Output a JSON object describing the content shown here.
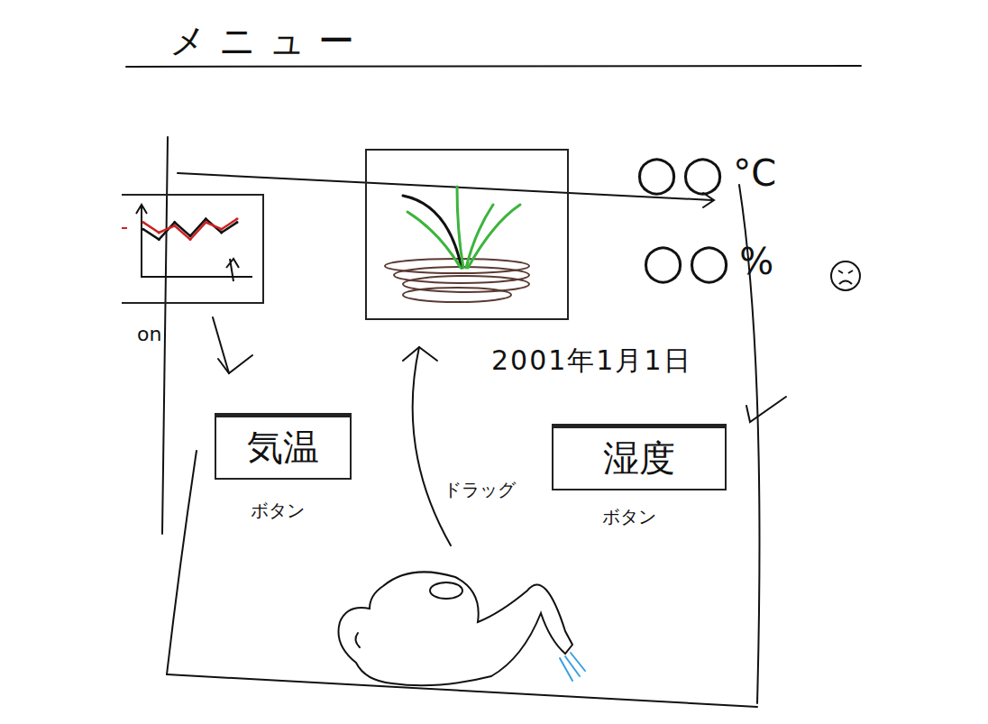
{
  "menu": {
    "title": "メニュー"
  },
  "chart": {
    "label": "on",
    "series": [
      {
        "name": "black",
        "values": [
          3,
          1.5,
          4,
          2,
          4.5,
          2.5,
          4
        ],
        "color": "#111111"
      },
      {
        "name": "red",
        "values": [
          4,
          2.5,
          3.5,
          1.5,
          4,
          3,
          4.5
        ],
        "color": "#cc2222"
      }
    ]
  },
  "readings": [
    {
      "value": "○○",
      "unit": "°C"
    },
    {
      "value": "○○",
      "unit": "%"
    }
  ],
  "date": "2001年1月1日",
  "buttons": [
    {
      "label": "気温",
      "caption": "ボタン"
    },
    {
      "label": "湿度",
      "caption": "ボタン"
    }
  ],
  "drag_label": "ドラッグ"
}
